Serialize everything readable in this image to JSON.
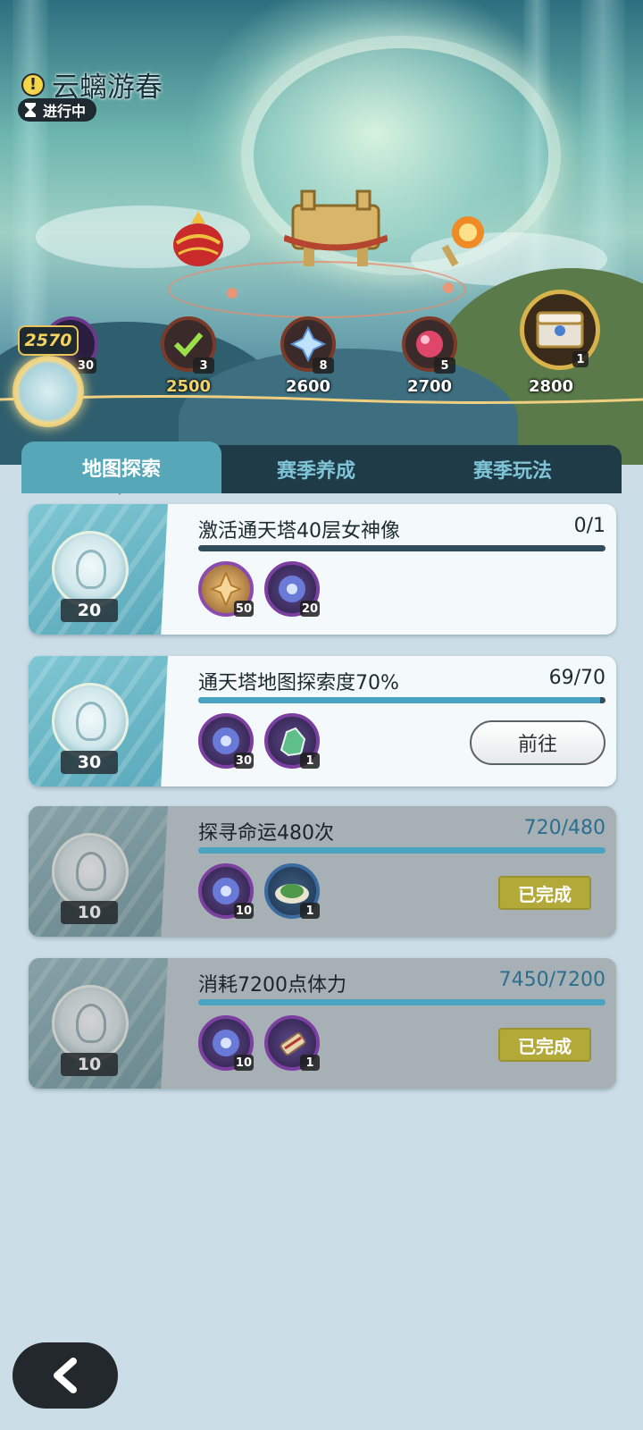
{
  "event": {
    "title": "云螭游春",
    "status": "进行中",
    "icon": "exclamation-icon"
  },
  "track": {
    "current_score": "2570",
    "milestones": [
      {
        "label": "2500",
        "reward_count": "3",
        "icon": "checkmark-reward-icon",
        "claimed": true
      },
      {
        "label": "2600",
        "reward_count": "8",
        "icon": "crystal-reward-icon"
      },
      {
        "label": "2700",
        "reward_count": "5",
        "icon": "red-gem-reward-icon"
      },
      {
        "label": "2800",
        "reward_count": "1",
        "icon": "treasure-chest-reward-icon"
      }
    ],
    "prev_reward_count": "30"
  },
  "tabs": [
    {
      "label": "地图探索",
      "active": true
    },
    {
      "label": "赛季养成",
      "active": false
    },
    {
      "label": "赛季玩法",
      "active": false
    }
  ],
  "tasks": [
    {
      "title": "激活通天塔40层女神像",
      "progress": "0/1",
      "progress_fraction": 0,
      "coin_count": "20",
      "rewards": [
        {
          "icon": "gold-star-crystal-icon",
          "count": "50"
        },
        {
          "icon": "purple-orb-icon",
          "count": "20"
        }
      ],
      "action": null,
      "done": false
    },
    {
      "title": "通天塔地图探索度70%",
      "progress": "69/70",
      "progress_fraction": 0.986,
      "coin_count": "30",
      "rewards": [
        {
          "icon": "purple-orb-icon",
          "count": "30"
        },
        {
          "icon": "green-ore-icon",
          "count": "1"
        }
      ],
      "action": "前往",
      "done": false
    },
    {
      "title": "探寻命运480次",
      "progress": "720/480",
      "progress_fraction": 1,
      "coin_count": "10",
      "rewards": [
        {
          "icon": "purple-orb-icon",
          "count": "10"
        },
        {
          "icon": "herb-plate-icon",
          "count": "1"
        }
      ],
      "action": null,
      "done": true,
      "done_label": "已完成"
    },
    {
      "title": "消耗7200点体力",
      "progress": "7450/7200",
      "progress_fraction": 1,
      "coin_count": "10",
      "rewards": [
        {
          "icon": "purple-orb-icon",
          "count": "10"
        },
        {
          "icon": "scroll-icon",
          "count": "1"
        }
      ],
      "action": null,
      "done": true,
      "done_label": "已完成"
    }
  ],
  "colors": {
    "accent_tab": "#56a7b7",
    "progress_fill": "#4aa3c0",
    "done_badge": "#b3a939",
    "score_gold": "#f4d35e"
  }
}
